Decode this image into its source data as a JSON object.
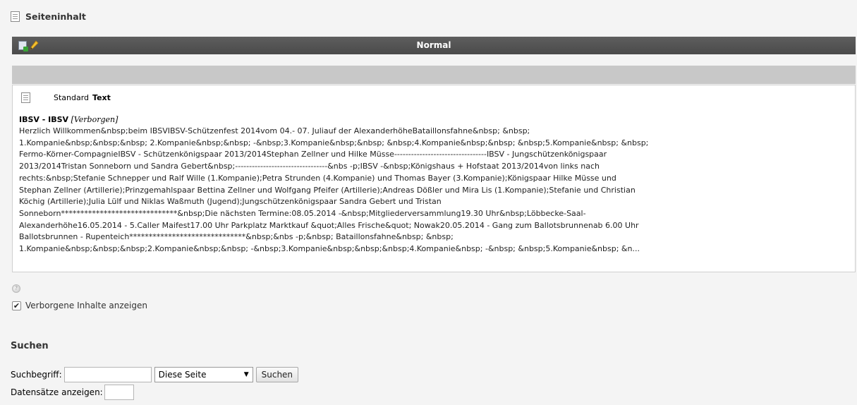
{
  "header": {
    "title": "Seiteninhalt",
    "icon": "page-content-icon"
  },
  "column": {
    "title": "Normal",
    "actions": [
      {
        "name": "new-content",
        "icon": "new-record-icon"
      },
      {
        "name": "edit-column",
        "icon": "pencil-icon"
      }
    ]
  },
  "element": {
    "icon": "text-content-icon",
    "type_label": "Standard",
    "type_value": "Text",
    "title": "IBSV - IBSV",
    "hidden_flag": "[Verborgen]",
    "body": "Herzlich Willkommen&nbsp;beim IBSVIBSV-Schützenfest 2014vom 04.- 07. Juliauf der AlexanderhöheBataillonsfahne&nbsp; &nbsp;\n1.Kompanie&nbsp;&nbsp;&nbsp; 2.Kompanie&nbsp;&nbsp; -&nbsp;3.Kompanie&nbsp;&nbsp; &nbsp;4.Kompanie&nbsp;&nbsp; &nbsp;5.Kompanie&nbsp; &nbsp;\nFermo-Körner-CompagnieIBSV - Schützenkönigspaar 2013/2014Stephan Zellner und Hilke Müsse---------------------------------IBSV - Jungschützenkönigspaar\n2013/2014Tristan Sonneborn und Sandra Gebert&nbsp;---------------------------------&nbs -p;IBSV -&nbsp;Königshaus + Hofstaat 2013/2014von links nach\nrechts:&nbsp;Stefanie Schnepper und Ralf Wille (1.Kompanie);Petra Strunden (4.Kompanie) und Thomas Bayer (3.Kompanie);Königspaar Hilke Müsse und\nStephan Zellner (Artillerie);Prinzgemahlspaar Bettina Zellner und Wolfgang Pfeifer (Artillerie);Andreas Dößler und Mira Lis (1.Kompanie);Stefanie und Christian\nKöchig (Artillerie);Julia Lülf und Niklas Waßmuth (Jugend);Jungschützenkönigspaar Sandra Gebert und Tristan\nSonneborn******************************&nbsp;Die nächsten Termine:08.05.2014 -&nbsp;Mitgliederversammlung19.30 Uhr&nbsp;Löbbecke-Saal-\nAlexanderhöhe16.05.2014 - 5.Caller Maifest17.00 Uhr Parkplatz Marktkauf &quot;Alles Frische&quot; Nowak20.05.2014 - Gang zum Ballotsbrunnenab 6.00 Uhr\nBallotsbrunnen - Rupenteich******************************&nbsp;&nbs -p;&nbsp; Bataillonsfahne&nbsp; &nbsp;\n1.Kompanie&nbsp;&nbsp;&nbsp;2.Kompanie&nbsp;&nbsp; -&nbsp;3.Kompanie&nbsp;&nbsp;&nbsp;4.Kompanie&nbsp; -&nbsp; &nbsp;5.Kompanie&nbsp; &n..."
  },
  "options": {
    "help_icon": "help-icon",
    "show_hidden_label": "Verborgene Inhalte anzeigen",
    "show_hidden_checked": true,
    "checkmark": "✔"
  },
  "search": {
    "heading": "Suchen",
    "term_label": "Suchbegriff:",
    "term_value": "",
    "scope_selected": "Diese Seite",
    "scope_arrow": "▼",
    "button_label": "Suchen",
    "records_label": "Datensätze anzeigen:",
    "records_value": ""
  },
  "colors": {
    "column_bar": "#4f4f4f",
    "strip": "#c8c8c8",
    "background": "#f4f4f4"
  }
}
